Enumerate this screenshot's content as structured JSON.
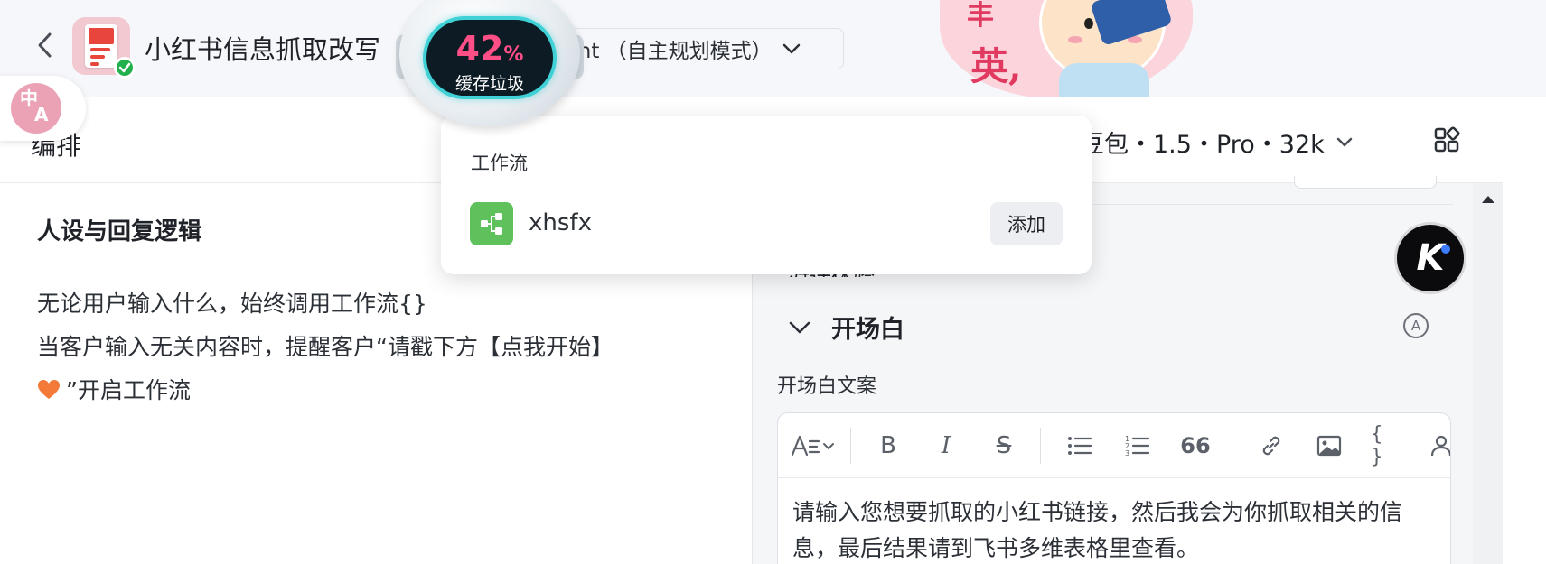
{
  "header": {
    "title": "小红书信息抓取改写",
    "mode_select": "gent （自主规划模式）"
  },
  "sticker": {
    "line1": "丰",
    "line2": "英,"
  },
  "translate": {
    "label_top": "中",
    "label_bottom": "A"
  },
  "cache_monitor": {
    "percent": "42",
    "unit": "%",
    "label": "缓存垃圾"
  },
  "editor": {
    "section_title": "编排",
    "model": "豆包・1.5・Pro・32k"
  },
  "prompt": {
    "heading": "人设与回复逻辑",
    "line1": "无论用户输入什么，始终调用工作流{}",
    "line2": "当客户输入无关内容时，提醒客户“请戳下方【点我开始】",
    "line3": "”开启工作流"
  },
  "workflow_popup": {
    "heading": "工作流",
    "item_name": "xhsfx",
    "add_label": "添加"
  },
  "right_panel": {
    "hidden_label": "对话体验",
    "opening_title": "开场白",
    "auto_badge": "A",
    "opening_sublabel": "开场白文案",
    "opening_text": "请输入您想要抓取的小红书链接，然后我会为你抓取相关的信息，最后结果请到飞书多维表格里查看。"
  },
  "toolbar": {
    "bold": "B",
    "italic": "I",
    "strike": "S",
    "quote": "66",
    "code": "{ }"
  },
  "avatar": {
    "letter": "K"
  },
  "colors": {
    "accent_green": "#5fc15c",
    "cache_pink": "#ff4f86",
    "cache_ring": "#3fd1d6",
    "check_green": "#21b04b"
  }
}
